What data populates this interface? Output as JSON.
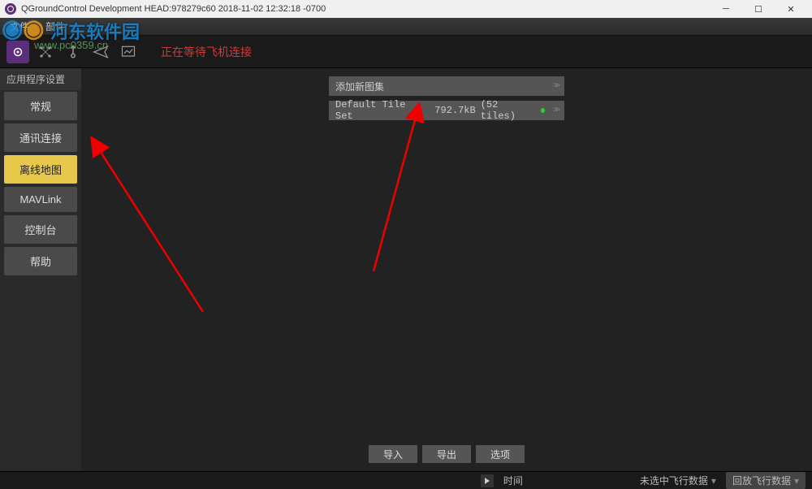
{
  "titlebar": {
    "title": "QGroundControl Development HEAD:978279c60 2018-11-02 12:32:18 -0700"
  },
  "menubar": {
    "items": [
      "文件",
      "部件"
    ]
  },
  "toolbar": {
    "status": "正在等待飞机连接"
  },
  "sidebar": {
    "title": "应用程序设置",
    "items": [
      {
        "label": "常规"
      },
      {
        "label": "通讯连接"
      },
      {
        "label": "离线地图"
      },
      {
        "label": "MAVLink"
      },
      {
        "label": "控制台"
      },
      {
        "label": "帮助"
      }
    ],
    "activeIndex": 2
  },
  "tilePanel": {
    "addLabel": "添加新图集",
    "defaultSet": {
      "name": "Default Tile Set",
      "size": "792.7kB",
      "tiles": "(52 tiles)"
    }
  },
  "bottomButtons": {
    "import": "导入",
    "export": "导出",
    "options": "选项"
  },
  "footer": {
    "time": "时间",
    "noData": "未选中飞行数据",
    "replay": "回放飞行数据"
  },
  "watermark": {
    "text": "河东软件园",
    "url": "www.pc0359.cn"
  }
}
